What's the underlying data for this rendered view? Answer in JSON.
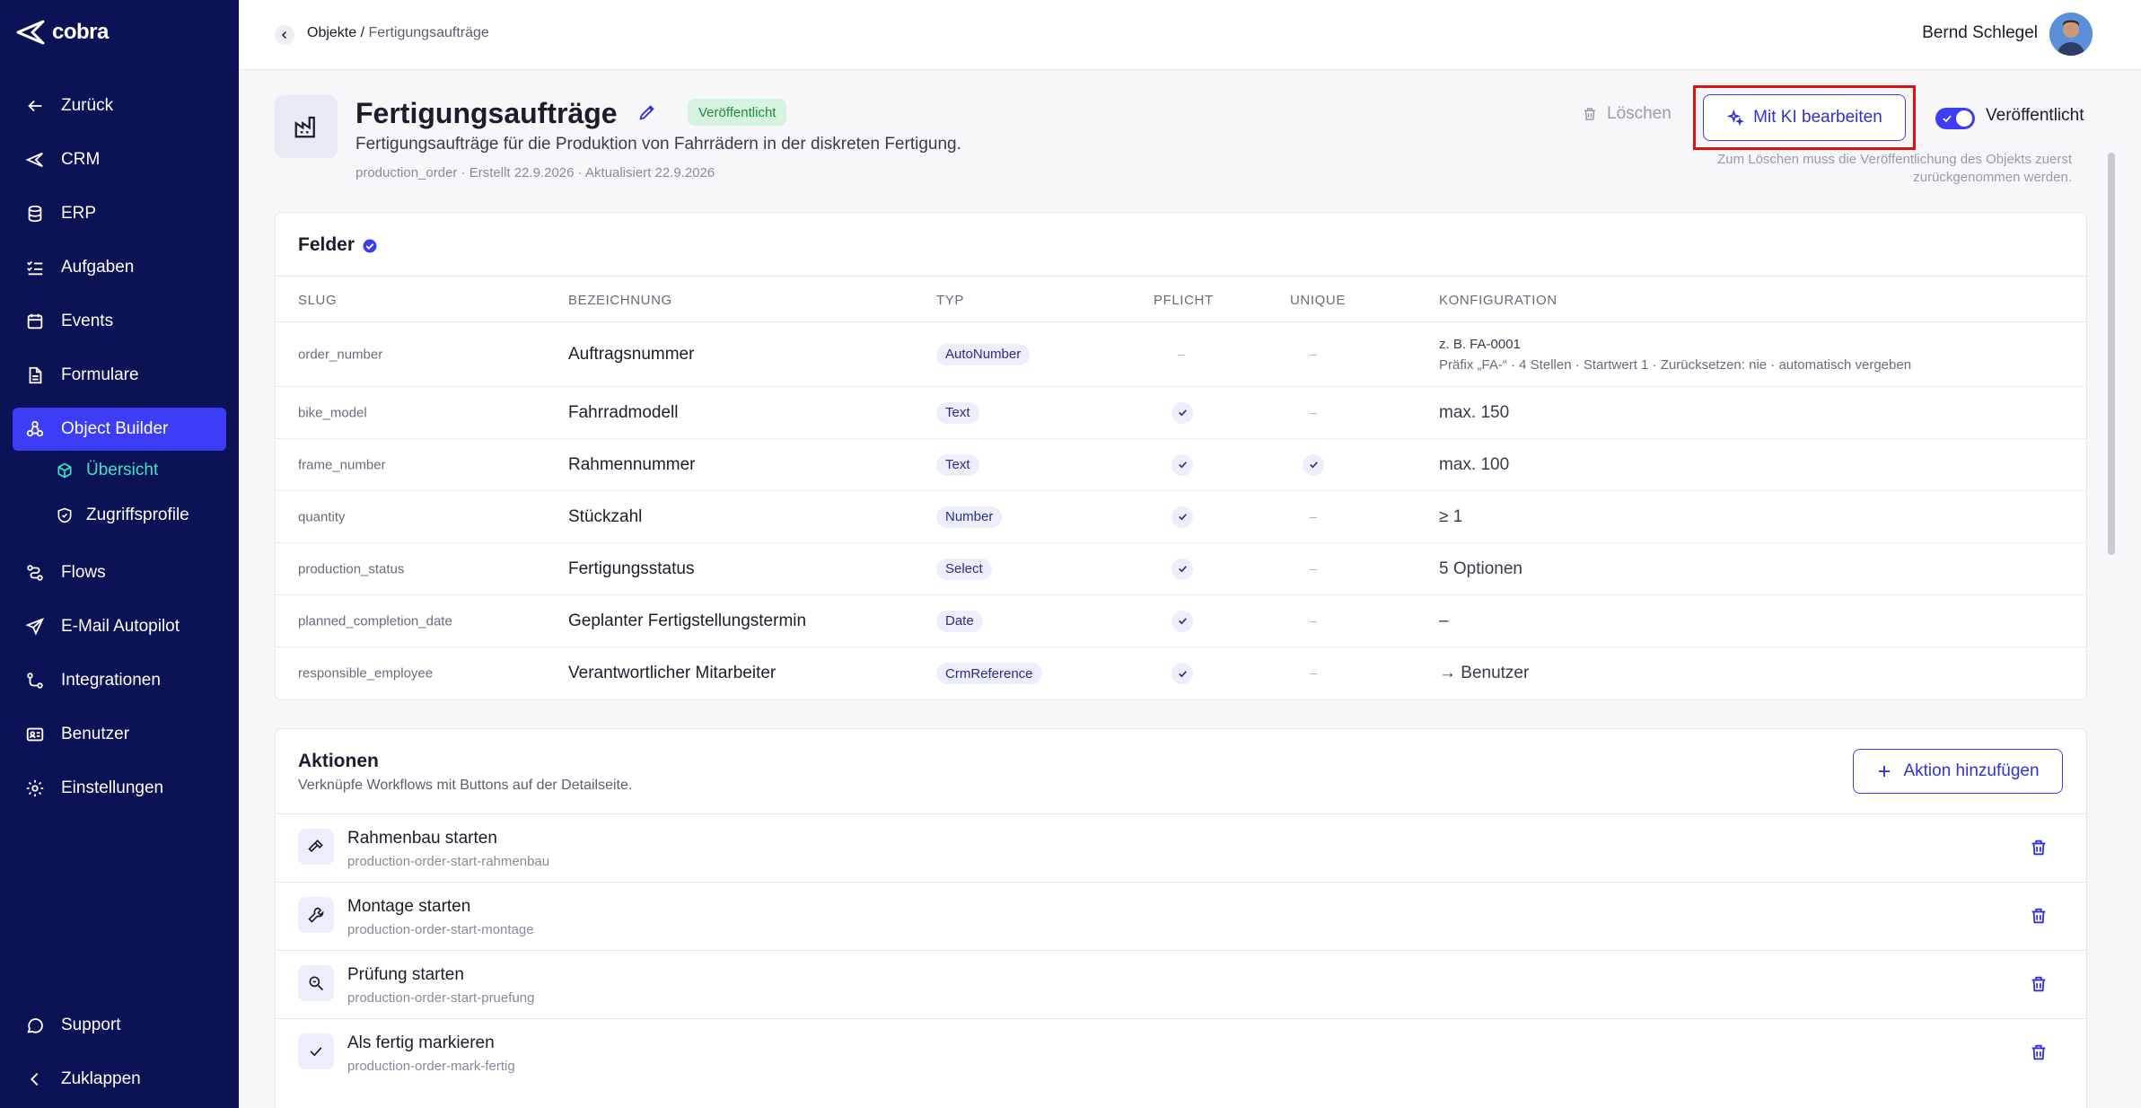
{
  "brand": {
    "name": "cobra"
  },
  "sidebar": {
    "items": [
      {
        "label": "Zurück",
        "icon": "arrow-left-icon"
      },
      {
        "label": "CRM",
        "icon": "crm-icon"
      },
      {
        "label": "ERP",
        "icon": "database-icon"
      },
      {
        "label": "Aufgaben",
        "icon": "list-check-icon"
      },
      {
        "label": "Events",
        "icon": "calendar-icon"
      },
      {
        "label": "Formulare",
        "icon": "file-icon"
      },
      {
        "label": "Object Builder",
        "icon": "object-builder-icon"
      },
      {
        "label": "Flows",
        "icon": "flows-icon"
      },
      {
        "label": "E-Mail Autopilot",
        "icon": "send-icon"
      },
      {
        "label": "Integrationen",
        "icon": "integrations-icon"
      },
      {
        "label": "Benutzer",
        "icon": "id-card-icon"
      },
      {
        "label": "Einstellungen",
        "icon": "gear-icon"
      }
    ],
    "sub_items": [
      {
        "label": "Übersicht",
        "icon": "cube-icon"
      },
      {
        "label": "Zugriffsprofile",
        "icon": "shield-icon"
      }
    ],
    "support_label": "Support",
    "collapse_label": "Zuklappen"
  },
  "header": {
    "breadcrumb_root": "Objekte",
    "breadcrumb_sep": " / ",
    "breadcrumb_current": "Fertigungsaufträge",
    "user_name": "Bernd Schlegel"
  },
  "object": {
    "title": "Fertigungsaufträge",
    "status_badge": "Veröffentlicht",
    "description": "Fertigungsaufträge für die Produktion von Fahrrädern in der diskreten Fertigung.",
    "meta": "production_order · Erstellt 22.9.2026 · Aktualisiert 22.9.2026",
    "delete_label": "Löschen",
    "ki_label": "Mit KI bearbeiten",
    "toggle_label": "Veröffentlicht",
    "delete_hint": "Zum Löschen muss die Veröffentlichung des Objekts zuerst zurückgenommen werden."
  },
  "fields": {
    "title": "Felder",
    "columns": [
      "SLUG",
      "BEZEICHNUNG",
      "TYP",
      "PFLICHT",
      "UNIQUE",
      "KONFIGURATION"
    ],
    "dash": "–",
    "rows": [
      {
        "slug": "order_number",
        "label": "Auftragsnummer",
        "type": "AutoNumber",
        "pflicht": false,
        "unique": false,
        "config_line1": "z. B. FA-0001",
        "config_line2": "Präfix „FA-“ · 4 Stellen · Startwert 1 · Zurücksetzen: nie · automatisch vergeben"
      },
      {
        "slug": "bike_model",
        "label": "Fahrradmodell",
        "type": "Text",
        "pflicht": true,
        "unique": false,
        "config": "max. 150"
      },
      {
        "slug": "frame_number",
        "label": "Rahmennummer",
        "type": "Text",
        "pflicht": true,
        "unique": true,
        "config": "max. 100"
      },
      {
        "slug": "quantity",
        "label": "Stückzahl",
        "type": "Number",
        "pflicht": true,
        "unique": false,
        "config": "≥ 1"
      },
      {
        "slug": "production_status",
        "label": "Fertigungsstatus",
        "type": "Select",
        "pflicht": true,
        "unique": false,
        "config": "5 Optionen"
      },
      {
        "slug": "planned_completion_date",
        "label": "Geplanter Fertigstellungstermin",
        "type": "Date",
        "pflicht": true,
        "unique": false,
        "config": "–"
      },
      {
        "slug": "responsible_employee",
        "label": "Verantwortlicher Mitarbeiter",
        "type": "CrmReference",
        "pflicht": true,
        "unique": false,
        "config": "→ Benutzer"
      }
    ]
  },
  "actions": {
    "title": "Aktionen",
    "subtitle": "Verknüpfe Workflows mit Buttons auf der Detailseite.",
    "add_label": "Aktion hinzufügen",
    "items": [
      {
        "name": "Rahmenbau starten",
        "slug": "production-order-start-rahmenbau",
        "icon": "hammer-icon"
      },
      {
        "name": "Montage starten",
        "slug": "production-order-start-montage",
        "icon": "wrench-icon"
      },
      {
        "name": "Prüfung starten",
        "slug": "production-order-start-pruefung",
        "icon": "zoom-search-icon"
      },
      {
        "name": "Als fertig markieren",
        "slug": "production-order-mark-fertig",
        "icon": "check-icon"
      }
    ]
  },
  "colors": {
    "sidebar_bg": "#0c1256",
    "accent": "#3d3df5",
    "active_sub": "#3de3c8",
    "highlight": "#e01010"
  }
}
